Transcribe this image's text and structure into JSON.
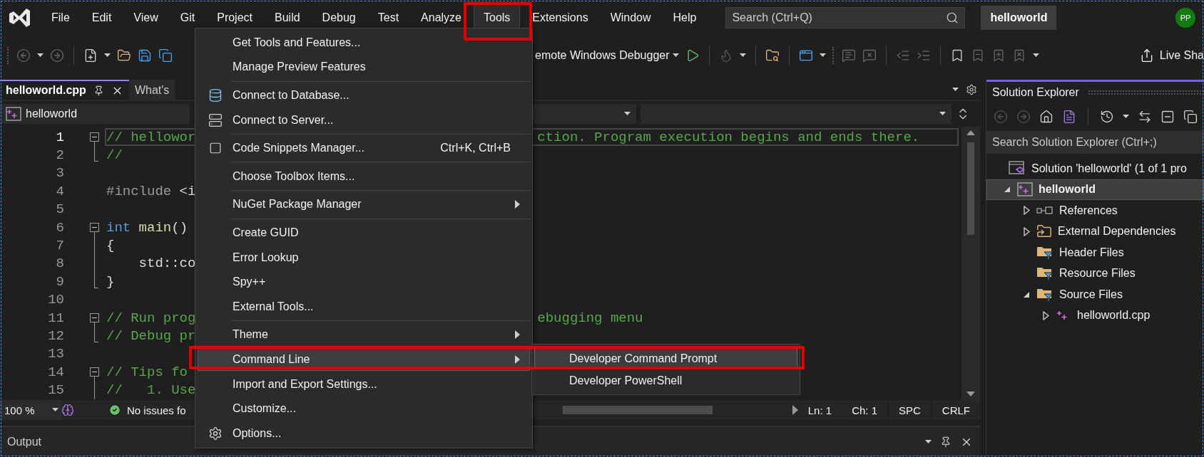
{
  "menubar": {
    "items": [
      {
        "label": "File",
        "selected": false,
        "highlighted": false
      },
      {
        "label": "Edit",
        "selected": false,
        "highlighted": false
      },
      {
        "label": "View",
        "selected": false,
        "highlighted": false
      },
      {
        "label": "Git",
        "selected": false,
        "highlighted": false
      },
      {
        "label": "Project",
        "selected": false,
        "highlighted": false
      },
      {
        "label": "Build",
        "selected": false,
        "highlighted": false
      },
      {
        "label": "Debug",
        "selected": false,
        "highlighted": false
      },
      {
        "label": "Test",
        "selected": false,
        "highlighted": false
      },
      {
        "label": "Analyze",
        "selected": false,
        "highlighted": false
      },
      {
        "label": "Tools",
        "selected": true,
        "highlighted": true
      },
      {
        "label": "Extensions",
        "selected": false,
        "highlighted": false
      },
      {
        "label": "Window",
        "selected": false,
        "highlighted": false
      },
      {
        "label": "Help",
        "selected": false,
        "highlighted": false
      }
    ]
  },
  "search": {
    "placeholder": "Search (Ctrl+Q)"
  },
  "solution_name": "helloworld",
  "avatar": "PP",
  "toolbar": {
    "debugger": "emote Windows Debugger",
    "live_share": "Live Sha"
  },
  "editor": {
    "tabs": [
      {
        "label": "helloworld.cpp",
        "selected": true
      },
      {
        "label": "What's",
        "selected": false
      }
    ],
    "nav": {
      "project": "helloworld"
    },
    "lines": [
      {
        "number": "1",
        "kind": "fold-start",
        "current": true,
        "left": [
          {
            "text": "// hellowor",
            "kind": "comment"
          }
        ],
        "right": [
          {
            "text": "ction. Program execution begins and ends there.",
            "kind": "comment"
          }
        ]
      },
      {
        "number": "2",
        "kind": "fold-end",
        "current": false,
        "left": [
          {
            "text": "//",
            "kind": "comment"
          }
        ]
      },
      {
        "number": "3",
        "kind": "plain",
        "current": false
      },
      {
        "number": "4",
        "kind": "plain",
        "current": false,
        "left": [
          {
            "text": "#include",
            "kind": "directive"
          },
          {
            "text": " <i",
            "kind": "plain"
          }
        ]
      },
      {
        "number": "5",
        "kind": "plain",
        "current": false
      },
      {
        "number": "6",
        "kind": "fold-start",
        "current": false,
        "left": [
          {
            "text": "int",
            "kind": "keyword"
          },
          {
            "text": " main",
            "kind": "function"
          },
          {
            "text": "()",
            "kind": "plain"
          }
        ]
      },
      {
        "number": "7",
        "kind": "fold-line",
        "current": false,
        "left": [
          {
            "text": "{",
            "kind": "plain"
          }
        ]
      },
      {
        "number": "8",
        "kind": "fold-line",
        "current": false,
        "left": [
          {
            "text": "    std::co",
            "kind": "plain"
          }
        ]
      },
      {
        "number": "9",
        "kind": "fold-end",
        "current": false,
        "left": [
          {
            "text": "}",
            "kind": "plain"
          }
        ]
      },
      {
        "number": "10",
        "kind": "plain",
        "current": false
      },
      {
        "number": "11",
        "kind": "fold-start",
        "current": false,
        "left": [
          {
            "text": "// Run prog",
            "kind": "comment"
          }
        ],
        "right": [
          {
            "text": "ebugging menu",
            "kind": "comment"
          }
        ]
      },
      {
        "number": "12",
        "kind": "fold-end",
        "current": false,
        "left": [
          {
            "text": "// Debug pr",
            "kind": "comment"
          }
        ]
      },
      {
        "number": "13",
        "kind": "plain",
        "current": false
      },
      {
        "number": "14",
        "kind": "fold-start",
        "current": false,
        "left": [
          {
            "text": "// Tips fo",
            "kind": "comment"
          }
        ]
      },
      {
        "number": "15",
        "kind": "fold-line",
        "current": false,
        "left": [
          {
            "text": "//   1. Use",
            "kind": "comment"
          }
        ]
      }
    ],
    "status": {
      "zoom": "100 %",
      "issues": "No issues fo",
      "line": "Ln: 1",
      "col": "Ch: 1",
      "indent": "SPC",
      "eol": "CRLF"
    }
  },
  "output": {
    "title": "Output"
  },
  "solution_explorer": {
    "title": "Solution Explorer",
    "search": {
      "placeholder": "Search Solution Explorer (Ctrl+;)"
    },
    "tree": [
      {
        "label": "Solution 'helloworld' (1 of 1 pro",
        "kind": "solution",
        "selected": false,
        "children": [
          {
            "label": "helloworld",
            "kind": "project",
            "selected": true,
            "expanded": true,
            "children": [
              {
                "label": "References",
                "kind": "references",
                "selected": false,
                "expanded": false
              },
              {
                "label": "External Dependencies",
                "kind": "external",
                "selected": false,
                "expanded": false
              },
              {
                "label": "Header Files",
                "kind": "filter",
                "selected": false
              },
              {
                "label": "Resource Files",
                "kind": "filter",
                "selected": false
              },
              {
                "label": "Source Files",
                "kind": "filter",
                "selected": false,
                "expanded": true,
                "children": [
                  {
                    "label": "helloworld.cpp",
                    "kind": "file",
                    "selected": false,
                    "expanded": false
                  }
                ]
              }
            ]
          }
        ]
      }
    ]
  },
  "tools_menu": {
    "items": [
      {
        "kind": "item",
        "label": "Get Tools and Features...",
        "selected": false,
        "highlighted": false
      },
      {
        "kind": "item",
        "label": "Manage Preview Features",
        "selected": false,
        "highlighted": false
      },
      {
        "kind": "separator"
      },
      {
        "kind": "item",
        "label": "Connect to Database...",
        "selected": false,
        "highlighted": false
      },
      {
        "kind": "item",
        "label": "Connect to Server...",
        "selected": false,
        "highlighted": false
      },
      {
        "kind": "separator"
      },
      {
        "kind": "item",
        "label": "Code Snippets Manager...",
        "shortcut": "Ctrl+K, Ctrl+B",
        "selected": false,
        "highlighted": false
      },
      {
        "kind": "separator"
      },
      {
        "kind": "item",
        "label": "Choose Toolbox Items...",
        "selected": false,
        "highlighted": false
      },
      {
        "kind": "separator"
      },
      {
        "kind": "item",
        "label": "NuGet Package Manager",
        "submenu": true,
        "selected": false,
        "highlighted": false
      },
      {
        "kind": "separator"
      },
      {
        "kind": "item",
        "label": "Create GUID",
        "selected": false,
        "highlighted": false
      },
      {
        "kind": "item",
        "label": "Error Lookup",
        "selected": false,
        "highlighted": false
      },
      {
        "kind": "item",
        "label": "Spy++",
        "selected": false,
        "highlighted": false
      },
      {
        "kind": "item",
        "label": "External Tools...",
        "selected": false,
        "highlighted": false
      },
      {
        "kind": "separator"
      },
      {
        "kind": "item",
        "label": "Theme",
        "submenu": true,
        "selected": false,
        "highlighted": false
      },
      {
        "kind": "item",
        "label": "Command Line",
        "submenu": true,
        "selected": true,
        "highlighted": true,
        "children": [
          {
            "label": "Developer Command Prompt",
            "selected": true
          },
          {
            "label": "Developer PowerShell",
            "selected": false
          }
        ]
      },
      {
        "kind": "item",
        "label": "Import and Export Settings...",
        "selected": false,
        "highlighted": false
      },
      {
        "kind": "item",
        "label": "Customize...",
        "selected": false,
        "highlighted": false
      },
      {
        "kind": "item",
        "label": "Options...",
        "selected": false,
        "highlighted": false
      }
    ]
  }
}
